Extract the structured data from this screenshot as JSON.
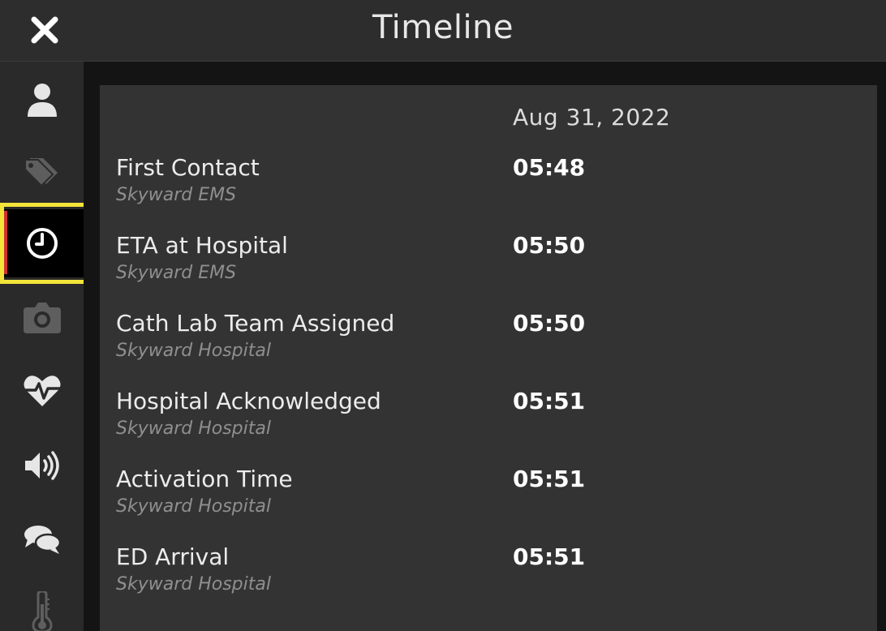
{
  "header": {
    "title": "Timeline",
    "close_icon": "close-icon"
  },
  "sidebar": {
    "items": [
      {
        "icon": "user-icon",
        "color": "#e6e6e6",
        "active": false
      },
      {
        "icon": "tags-icon",
        "color": "#5e5e5e",
        "active": false
      },
      {
        "icon": "clock-icon",
        "color": "#ffffff",
        "active": true
      },
      {
        "icon": "camera-icon",
        "color": "#5e5e5e",
        "active": false
      },
      {
        "icon": "heartbeat-icon",
        "color": "#e6e6e6",
        "active": false
      },
      {
        "icon": "volume-icon",
        "color": "#e6e6e6",
        "active": false
      },
      {
        "icon": "chat-icon",
        "color": "#e6e6e6",
        "active": false
      },
      {
        "icon": "thermometer-icon",
        "color": "#5e5e5e",
        "active": false
      }
    ],
    "active_indicator_color": "#cc3333",
    "highlight_color": "#f3e43a"
  },
  "timeline": {
    "date": "Aug 31, 2022",
    "events": [
      {
        "name": "First Contact",
        "source": "Skyward EMS",
        "time": "05:48"
      },
      {
        "name": "ETA at Hospital",
        "source": "Skyward EMS",
        "time": "05:50"
      },
      {
        "name": "Cath Lab Team Assigned",
        "source": "Skyward Hospital",
        "time": "05:50"
      },
      {
        "name": "Hospital Acknowledged",
        "source": "Skyward Hospital",
        "time": "05:51"
      },
      {
        "name": "Activation Time",
        "source": "Skyward Hospital",
        "time": "05:51"
      },
      {
        "name": "ED Arrival",
        "source": "Skyward Hospital",
        "time": "05:51"
      }
    ]
  }
}
